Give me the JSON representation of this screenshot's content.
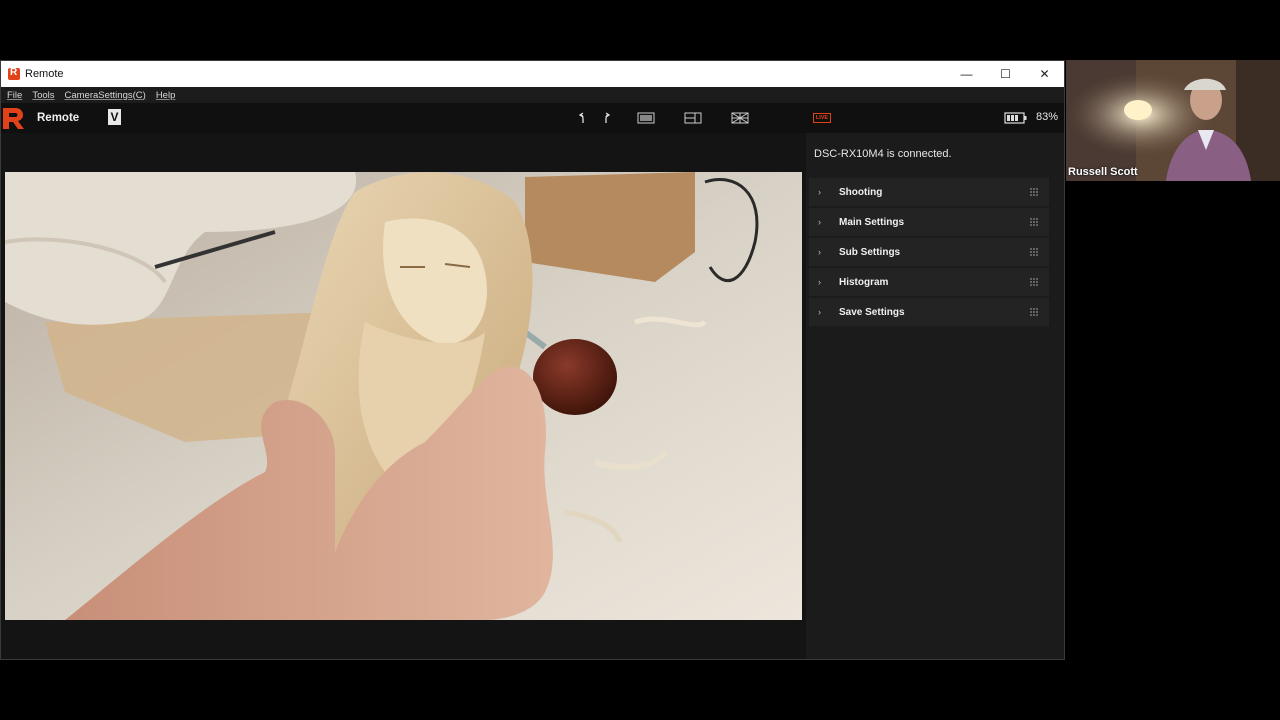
{
  "window": {
    "title": "Remote",
    "controls": {
      "minimize": "—",
      "maximize": "☐",
      "close": "✕"
    }
  },
  "menu": [
    {
      "label": "File"
    },
    {
      "label": "Tools"
    },
    {
      "label": "CameraSettings(C)"
    },
    {
      "label": "Help"
    }
  ],
  "toolbar": {
    "mode_label": "Remote",
    "v_icon": "V",
    "live_badge": "LIVE",
    "battery": "83%",
    "icons": [
      "rotate-left-icon",
      "rotate-right-icon",
      "single-view-icon",
      "split-view-icon",
      "grid-view-icon",
      "live-icon",
      "battery-icon"
    ]
  },
  "panel": {
    "status": "DSC-RX10M4 is connected.",
    "sections": [
      {
        "label": "Shooting"
      },
      {
        "label": "Main Settings"
      },
      {
        "label": "Sub Settings"
      },
      {
        "label": "Histogram"
      },
      {
        "label": "Save Settings"
      }
    ]
  },
  "webcam": {
    "name": "Russell Scott"
  },
  "colors": {
    "accent": "#e2421a",
    "panel_bg": "#1b1b1b",
    "section_bg": "#232323"
  }
}
